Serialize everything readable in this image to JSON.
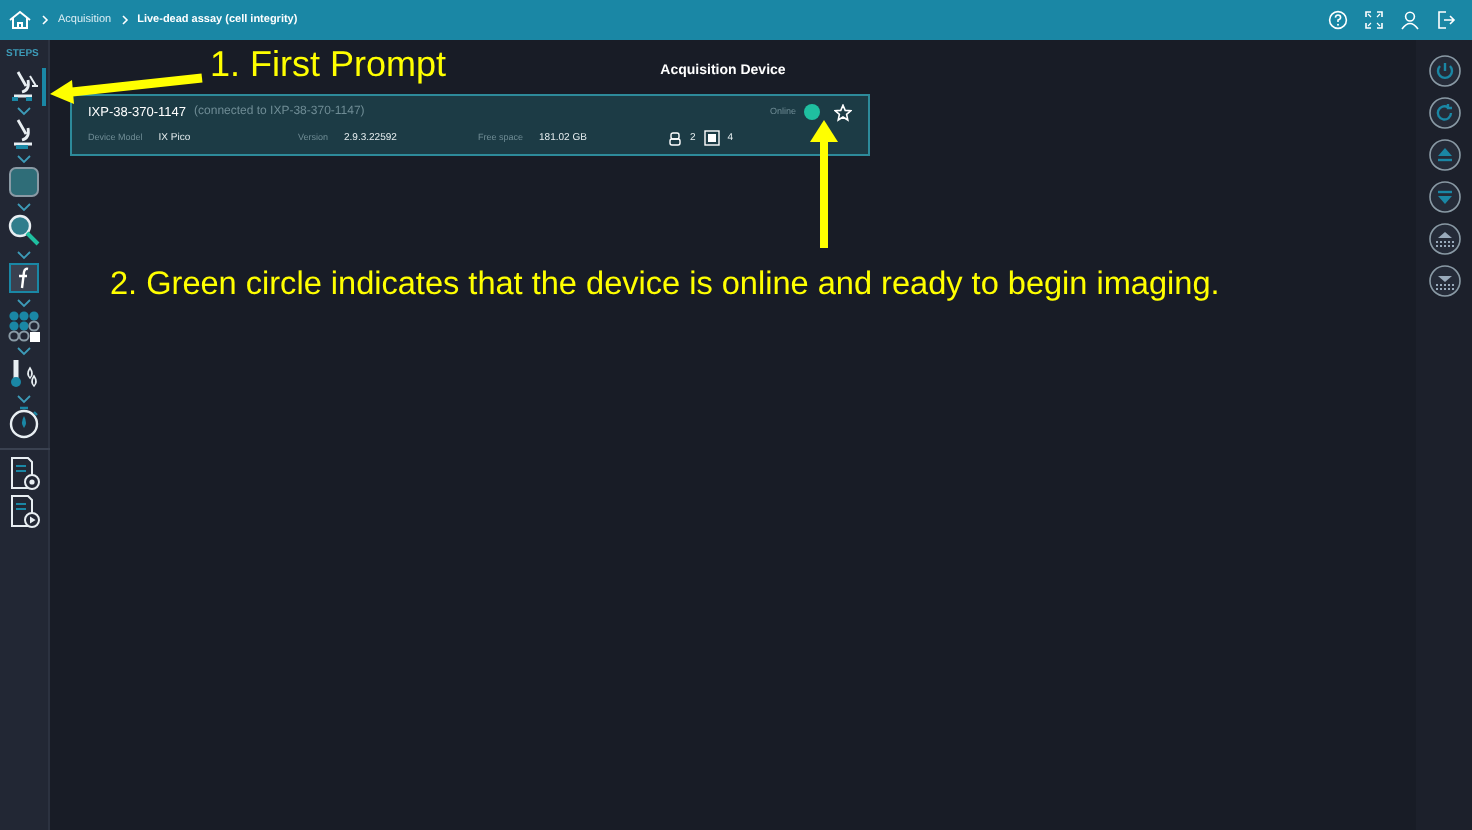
{
  "topbar": {
    "breadcrumb": [
      "Acquisition",
      "Live-dead assay (cell integrity)"
    ]
  },
  "sidebar": {
    "title": "STEPS",
    "steps": [
      {
        "kind": "microscope-arrows",
        "selected": true
      },
      {
        "kind": "microscope",
        "selected": false
      },
      {
        "kind": "plate",
        "selected": false
      },
      {
        "kind": "focus",
        "selected": false
      },
      {
        "kind": "function",
        "selected": false
      },
      {
        "kind": "wells",
        "selected": false
      },
      {
        "kind": "thermo",
        "selected": false
      },
      {
        "kind": "timer",
        "selected": false
      }
    ],
    "reports": [
      {
        "kind": "doc-gear"
      },
      {
        "kind": "doc-play"
      }
    ]
  },
  "main": {
    "heading": "Acquisition Device",
    "device": {
      "name": "IXP-38-370-1147",
      "connection": "(connected to IXP-38-370-1147)",
      "status": "Online",
      "color": "#1fbfa0",
      "favorite": false,
      "fields": [
        {
          "label": "Device Model",
          "value": "IX Pico"
        },
        {
          "label": "Version",
          "value": "2.9.3.22592"
        },
        {
          "label": "Free space",
          "value": "181.02 GB"
        }
      ],
      "objectives": "2",
      "plates": "4"
    }
  },
  "annotations": [
    {
      "text": "1. First Prompt"
    },
    {
      "text": "2. Green circle indicates that the device is online and ready to begin imaging."
    }
  ]
}
